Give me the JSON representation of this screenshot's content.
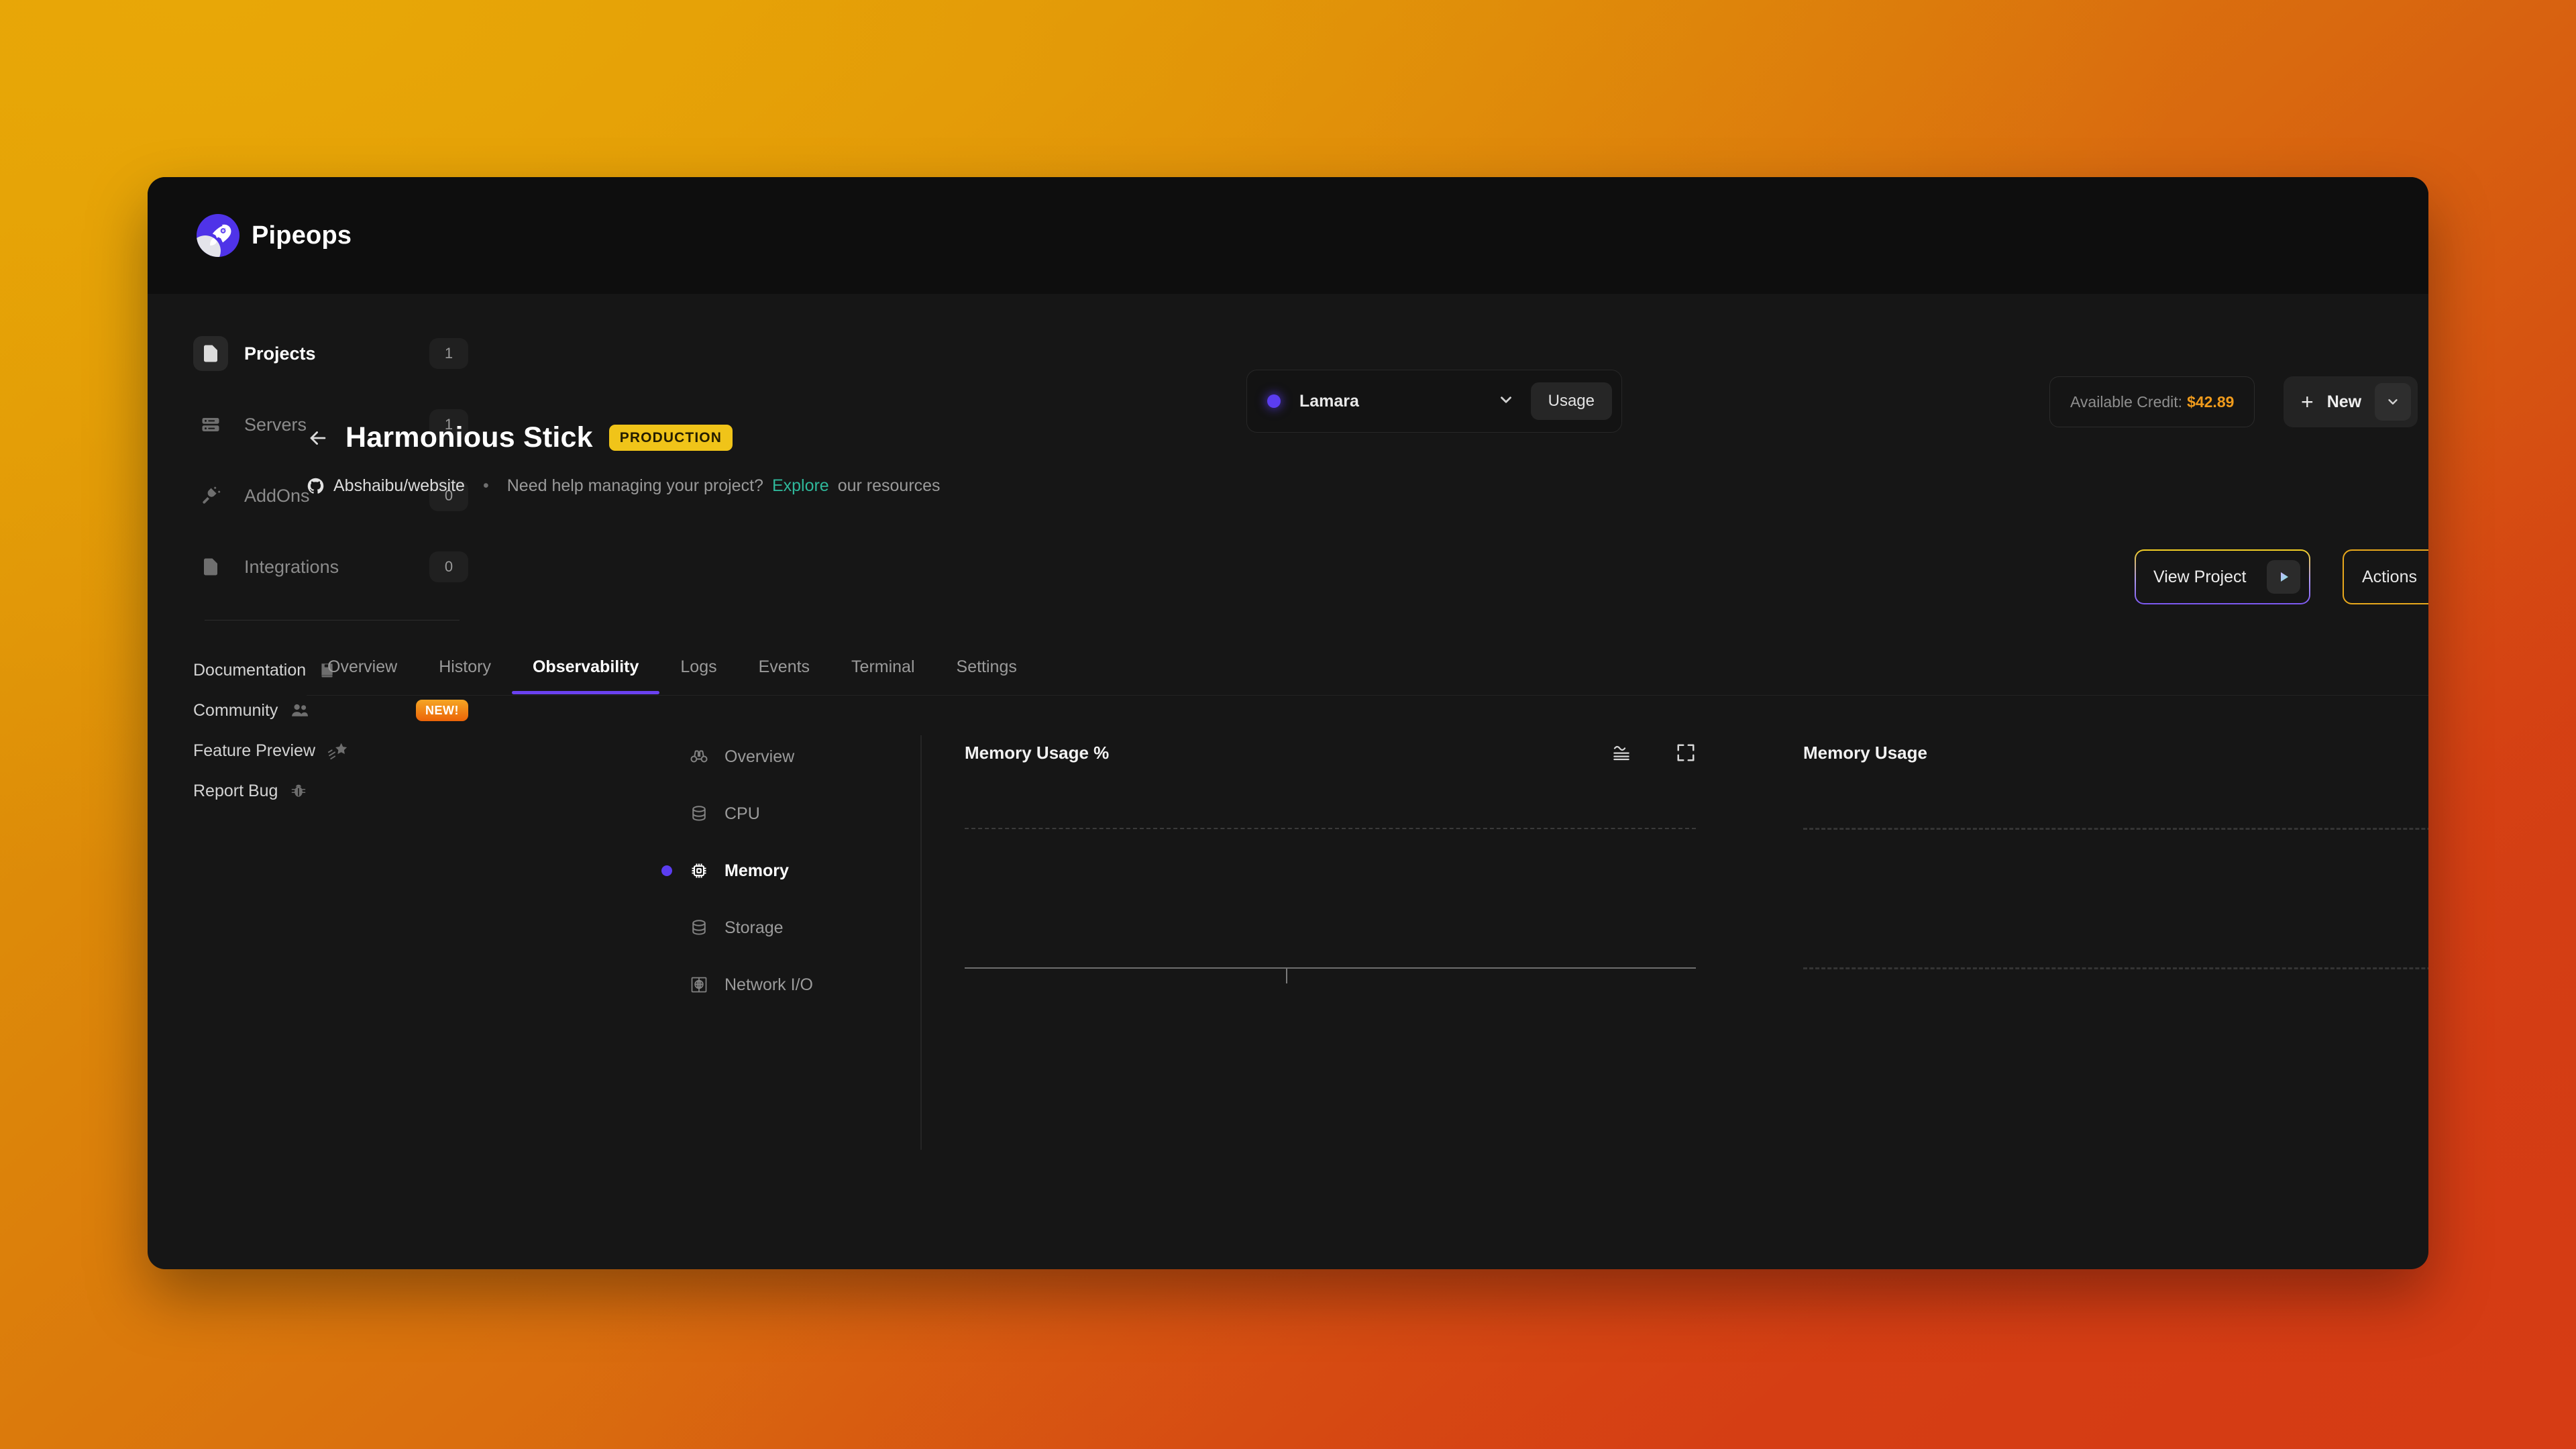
{
  "brand": {
    "name": "Pipeops",
    "mark_icon": "rocket-icon"
  },
  "topbar": {
    "org": {
      "name": "Lamara",
      "status_icon": "status-dot",
      "caret_icon": "chevron-down-icon"
    },
    "usage_label": "Usage",
    "credit_label": "Available Credit:",
    "credit_amount": "$42.89",
    "new_label": "New",
    "new_plus_icon": "plus-icon",
    "new_caret_icon": "chevron-down-icon",
    "power_icon": "power-icon",
    "power_caret_icon": "chevron-down-icon"
  },
  "sidebar": {
    "items": [
      {
        "label": "Projects",
        "count": "1",
        "icon": "file-icon",
        "active": true
      },
      {
        "label": "Servers",
        "count": "1",
        "icon": "server-icon",
        "active": false
      },
      {
        "label": "AddOns",
        "count": "0",
        "icon": "plug-icon",
        "active": false
      },
      {
        "label": "Integrations",
        "count": "0",
        "icon": "file-icon",
        "active": false
      }
    ],
    "links": [
      {
        "label": "Documentation",
        "icon": "book-icon",
        "badge": ""
      },
      {
        "label": "Community",
        "icon": "users-icon",
        "badge": "NEW!"
      },
      {
        "label": "Feature Preview",
        "icon": "shooting-star-icon",
        "badge": ""
      },
      {
        "label": "Report Bug",
        "icon": "bug-icon",
        "badge": ""
      }
    ]
  },
  "project": {
    "back_icon": "arrow-left-icon",
    "title": "Harmonious Stick",
    "env_badge": "PRODUCTION",
    "repo_icon": "github-icon",
    "repo": "Abshaibu/website",
    "separator": "•",
    "help_text": "Need help managing your project?",
    "explore_link": "Explore",
    "help_suffix": "our resources",
    "view_project_label": "View Project",
    "view_project_icon": "play-icon",
    "actions_label": "Actions",
    "actions_icon": "chevron-down-icon"
  },
  "tabs": [
    {
      "label": "Overview",
      "active": false
    },
    {
      "label": "History",
      "active": false
    },
    {
      "label": "Observability",
      "active": true
    },
    {
      "label": "Logs",
      "active": false
    },
    {
      "label": "Events",
      "active": false
    },
    {
      "label": "Terminal",
      "active": false
    },
    {
      "label": "Settings",
      "active": false
    }
  ],
  "observability_nav": [
    {
      "label": "Overview",
      "icon": "binoculars-icon",
      "active": false
    },
    {
      "label": "CPU",
      "icon": "database-icon",
      "active": false
    },
    {
      "label": "Memory",
      "icon": "chip-icon",
      "active": true
    },
    {
      "label": "Storage",
      "icon": "database-icon",
      "active": false
    },
    {
      "label": "Network I/O",
      "icon": "network-icon",
      "active": false
    }
  ],
  "charts": [
    {
      "title": "Memory Usage %",
      "waveform_icon": "waveform-icon",
      "expand_icon": "expand-icon"
    },
    {
      "title": "Memory Usage",
      "waveform_icon": "waveform-icon",
      "expand_icon": "expand-icon"
    }
  ],
  "chart_data": [
    {
      "type": "line",
      "title": "Memory Usage %",
      "x": [],
      "values": [],
      "series": [
        {
          "name": "Memory Usage %",
          "values": []
        }
      ],
      "xlabel": "",
      "ylabel": "",
      "ylim": [
        0,
        100
      ],
      "grid": true,
      "legend": "none",
      "note": "Empty plot - no data series rendered; only a dashed upper gridline and a solid baseline axis with a single centre tick are visible."
    },
    {
      "type": "line",
      "title": "Memory Usage",
      "x": [],
      "values": [],
      "series": [
        {
          "name": "Memory Usage",
          "values": []
        }
      ],
      "xlabel": "",
      "ylabel": "",
      "ylim": [
        0,
        100
      ],
      "grid": true,
      "legend": "none",
      "note": "Empty plot - no data series rendered; two dashed horizontal gridlines (top and bottom) visible."
    }
  ],
  "colors": {
    "accent_purple": "#5b3df0",
    "brand_purple": "#4f33e8",
    "env_badge_yellow": "#f0c419",
    "credit_orange": "#f09b1c",
    "explore_teal": "#2fb79a",
    "actions_border": "#e8a81c",
    "power_blue": "#1689d8",
    "window_bg": "#161616",
    "topbar_bg": "#0e0e0e"
  }
}
